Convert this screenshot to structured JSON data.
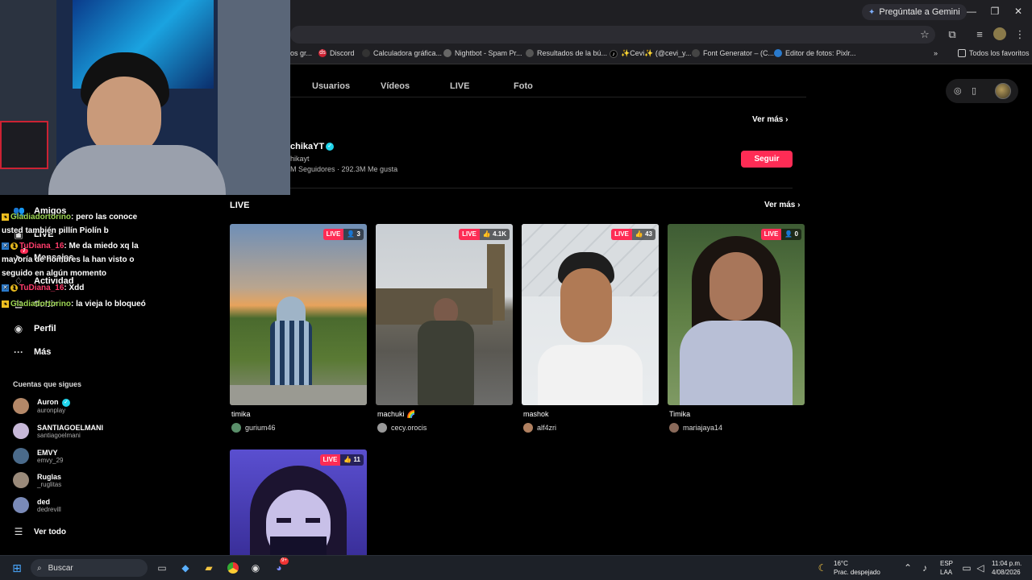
{
  "browser": {
    "gemini_button": "Pregúntale a Gemini",
    "window_controls": {
      "minimize": "—",
      "restore": "❐",
      "close": "✕"
    },
    "bookmarks": [
      {
        "label": "os gr...",
        "icon": ""
      },
      {
        "label": "Discord",
        "icon": "ds"
      },
      {
        "label": "Calculadora gráfica...",
        "icon": ""
      },
      {
        "label": "Nightbot - Spam Pr...",
        "icon": ""
      },
      {
        "label": "Resultados de la bú...",
        "icon": ""
      },
      {
        "label": "✨Cevi✨ (@cevi_y...",
        "icon": "♪"
      },
      {
        "label": "Font Generator – (C...",
        "icon": ""
      },
      {
        "label": "Editor de fotos: Pixlr...",
        "icon": ""
      }
    ],
    "all_favorites": "Todos los favoritos",
    "more_bookmarks": "»"
  },
  "tabs": [
    "Usuarios",
    "Vídeos",
    "LIVE",
    "Foto"
  ],
  "accounts": {
    "ver_mas": "Ver más",
    "user": {
      "name": "chikaYT",
      "handle": "hikayt",
      "followers": "M Seguidores",
      "likes": "292.3M Me gusta"
    },
    "follow_button": "Seguir"
  },
  "live": {
    "heading": "LIVE",
    "ver_mas": "Ver más",
    "badge_label": "LIVE",
    "cards": [
      {
        "title": "timika",
        "host": "gurium46",
        "count": "3",
        "count_icon": "👤"
      },
      {
        "title": "machuki 🌈",
        "host": "cecy.orocis",
        "count": "4.1K",
        "count_icon": "👍"
      },
      {
        "title": "mashok",
        "host": "alf4zri",
        "count": "43",
        "count_icon": "👍"
      },
      {
        "title": "Timika",
        "host": "mariajaya14",
        "count": "0",
        "count_icon": "👤"
      },
      {
        "title": "",
        "host": "",
        "count": "11",
        "count_icon": "👍"
      }
    ]
  },
  "nav": {
    "items": [
      {
        "label": "Amigos",
        "icon": "people-icon"
      },
      {
        "label": "LIVE",
        "icon": "live-icon"
      },
      {
        "label": "Mensajes",
        "icon": "send-icon",
        "badge": "7"
      },
      {
        "label": "Actividad",
        "icon": "bell-icon"
      },
      {
        "label": "Subir",
        "icon": "upload-icon"
      },
      {
        "label": "Perfil",
        "icon": "avatar-icon"
      },
      {
        "label": "Más",
        "icon": "more-icon"
      }
    ],
    "following_title": "Cuentas que sigues",
    "following": [
      {
        "name": "Auron",
        "handle": "auronplay",
        "verified": "✓"
      },
      {
        "name": "SANTIAGOELMANI",
        "handle": "santiagoelmani"
      },
      {
        "name": "EMVY",
        "handle": "emvy_29"
      },
      {
        "name": "Ruglas",
        "handle": "_ruglitas"
      },
      {
        "name": "ded",
        "handle": "dedrevill"
      }
    ],
    "see_all": "Ver todo"
  },
  "chat": [
    {
      "user": "Gladiadortorino",
      "text": ": pero las conoce"
    },
    {
      "user": "",
      "text": "usted también pillín Piolín b"
    },
    {
      "user": "TuDiana_16",
      "text": ": Me da miedo xq la"
    },
    {
      "user": "",
      "text": "mayoría de hombres la han visto o"
    },
    {
      "user": "",
      "text": "seguido en algún momento"
    },
    {
      "user": "TuDiana_16",
      "text": ": Xdd"
    },
    {
      "user": "Gladiadortorino",
      "text": ": la vieja lo bloqueó"
    }
  ],
  "taskbar": {
    "search_placeholder": "Buscar",
    "weather_temp": "16°C",
    "weather_desc": "Prac. despejado",
    "lang_line1": "ESP",
    "lang_line2": "LAA",
    "time": "11:04 p.m.",
    "date": "4/08/2026",
    "notification_badge": "9+"
  }
}
